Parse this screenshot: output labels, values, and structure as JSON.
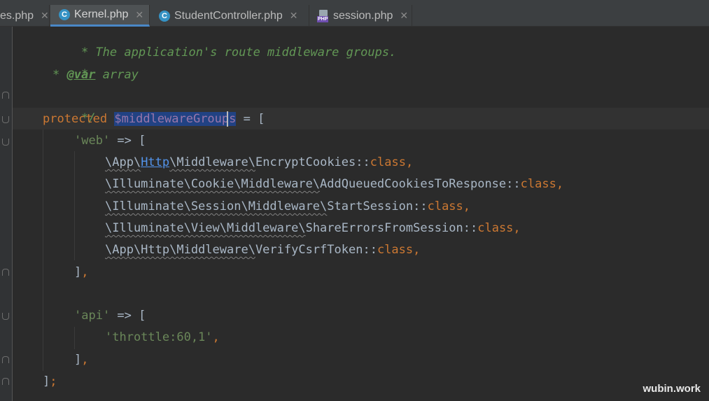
{
  "tabs": [
    {
      "label": "es.php",
      "icon": "php-file-icon",
      "active": false
    },
    {
      "label": "Kernel.php",
      "icon": "class-c-icon",
      "icon_glyph": "C",
      "active": true
    },
    {
      "label": "StudentController.php",
      "icon": "class-c-icon",
      "icon_glyph": "C",
      "active": false
    },
    {
      "label": "session.php",
      "icon": "php-file-icon",
      "icon_glyph": "PHP",
      "active": false
    }
  ],
  "close_glyph": "✕",
  "code": {
    "l1": "* The application's route middleware groups.",
    "l2": "*",
    "l3_star": "* ",
    "l3_tag": "@var",
    "l3_rest": " array",
    "l4": "*/",
    "l5_kw": "protected",
    "l5_var": "$middlewareGroups",
    "l5_rest": " = [",
    "l6_str": "'web'",
    "l6_rest": " => [",
    "l7": {
      "ns1": "\\App\\",
      "link": "Http",
      "ns2": "\\Middleware\\",
      "cls": "EncryptCookies",
      "sep": "::",
      "kw": "class",
      "end": ","
    },
    "l8": {
      "ns": "\\Illuminate\\Cookie\\Middleware\\",
      "cls": "AddQueuedCookiesToResponse",
      "sep": "::",
      "kw": "class",
      "end": ","
    },
    "l9": {
      "ns": "\\Illuminate\\Session\\Middleware\\",
      "cls": "StartSession",
      "sep": "::",
      "kw": "class",
      "end": ","
    },
    "l10": {
      "ns": "\\Illuminate\\View\\Middleware\\",
      "cls": "ShareErrorsFromSession",
      "sep": "::",
      "kw": "class",
      "end": ","
    },
    "l11": {
      "ns": "\\App\\Http\\Middleware\\",
      "cls": "VerifyCsrfToken",
      "sep": "::",
      "kw": "class",
      "end": ","
    },
    "l12_br": "]",
    "l12_end": ",",
    "l14_str": "'api'",
    "l14_rest": " => [",
    "l15_str": "'throttle:60,1'",
    "l15_end": ",",
    "l16_br": "]",
    "l16_end": ",",
    "l17_br": "]",
    "l17_end": ";"
  },
  "watermark": "wubin.work"
}
